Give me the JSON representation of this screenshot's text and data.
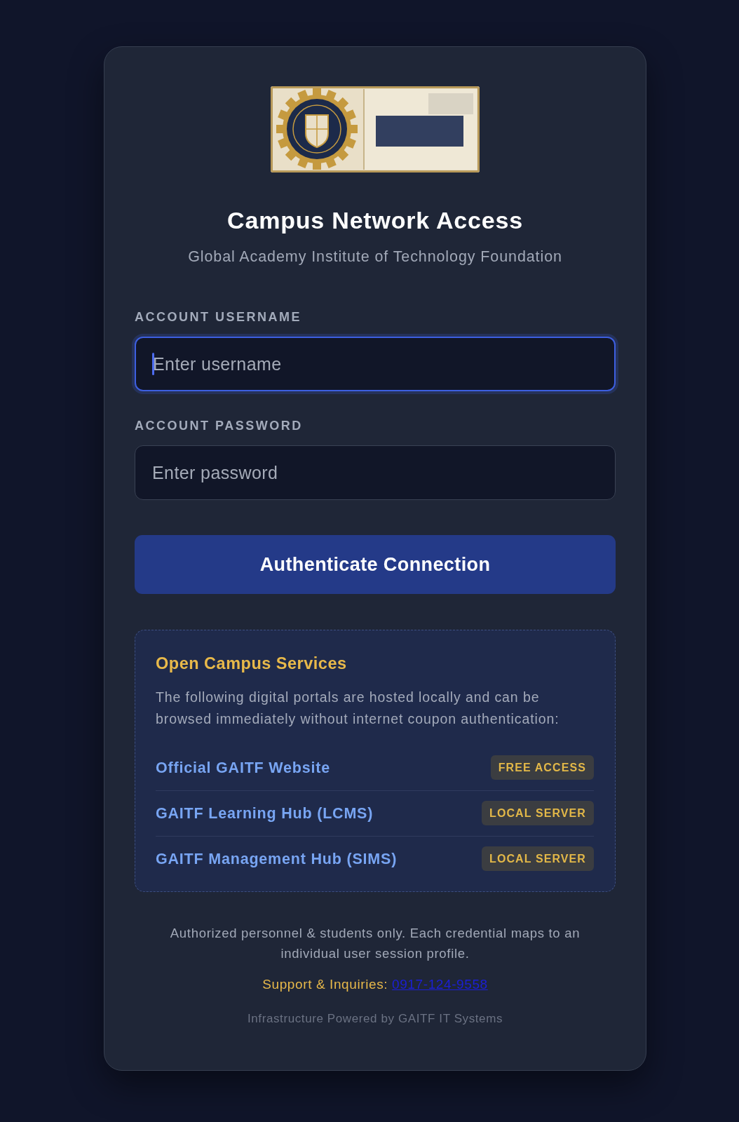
{
  "header": {
    "title": "Campus Network Access",
    "subtitle": "Global Academy Institute of Technology Foundation"
  },
  "form": {
    "fields": [
      {
        "label": "ACCOUNT USERNAME",
        "placeholder": "Enter username",
        "focused": true
      },
      {
        "label": "ACCOUNT PASSWORD",
        "placeholder": "Enter password",
        "focused": false
      }
    ],
    "submit": "Authenticate Connection"
  },
  "services": {
    "title": "Open Campus Services",
    "description": "The following digital portals are hosted locally and can be browsed immediately without internet coupon authentication:",
    "items": [
      {
        "name": "Official GAITF Website",
        "tag": "FREE ACCESS"
      },
      {
        "name": "GAITF Learning Hub (LCMS)",
        "tag": "LOCAL SERVER"
      },
      {
        "name": "GAITF Management Hub (SIMS)",
        "tag": "LOCAL SERVER"
      }
    ]
  },
  "footer": {
    "notice": "Authorized personnel & students only. Each credential maps to an individual user session profile.",
    "support_label": "Support & Inquiries:",
    "support_phone": "0917-124-9558",
    "credit": "Infrastructure Powered by GAITF IT Systems"
  }
}
